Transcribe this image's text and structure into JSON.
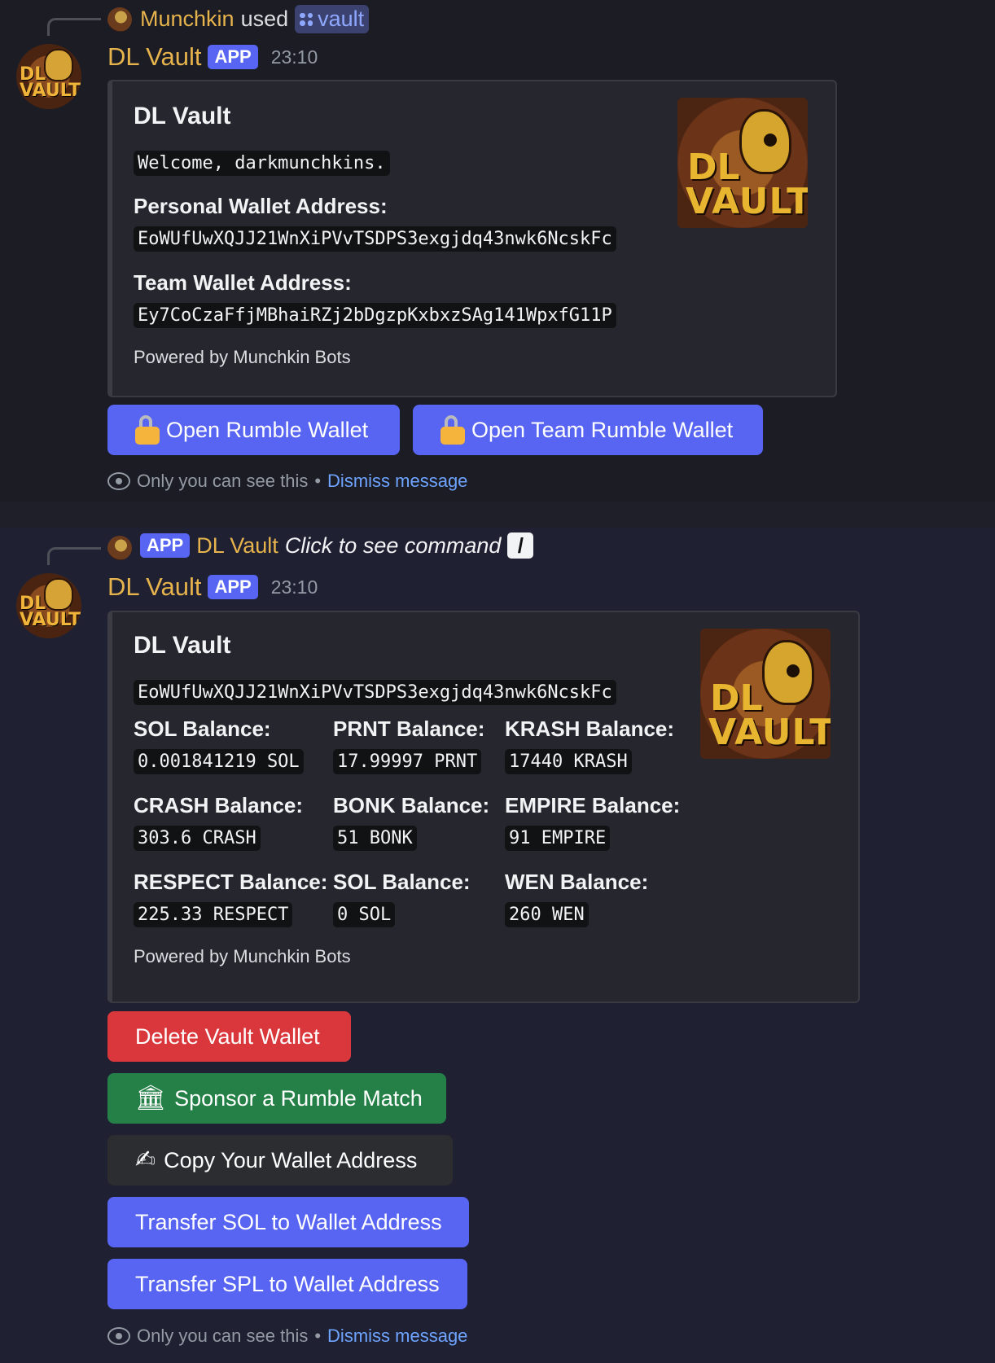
{
  "message1": {
    "reply": {
      "user": "Munchkin",
      "used": "used",
      "command": "vault"
    },
    "bot_name": "DL Vault",
    "badge": "APP",
    "time": "23:10",
    "embed": {
      "title": "DL Vault",
      "welcome": "Welcome, darkmunchkins.",
      "personal_label": "Personal Wallet Address:",
      "personal_address": "EoWUfUwXQJJ21WnXiPVvTSDPS3exgjdq43nwk6NcskFc",
      "team_label": "Team Wallet Address:",
      "team_address": "Ey7CoCzaFfjMBhaiRZj2bDgzpKxbxzSAg141WpxfG11P",
      "footer": "Powered by Munchkin Bots",
      "thumb_line1": "DL",
      "thumb_line2": "VAULT"
    },
    "buttons": {
      "open_rumble": "Open Rumble Wallet",
      "open_team_rumble": "Open Team Rumble Wallet"
    },
    "ephemeral": {
      "note": "Only you can see this",
      "sep": "•",
      "dismiss": "Dismiss message"
    }
  },
  "message2": {
    "reply": {
      "badge": "APP",
      "name": "DL Vault",
      "click": "Click to see command",
      "slash": "/"
    },
    "bot_name": "DL Vault",
    "badge": "APP",
    "time": "23:10",
    "embed": {
      "title": "DL Vault",
      "address": "EoWUfUwXQJJ21WnXiPVvTSDPS3exgjdq43nwk6NcskFc",
      "balances": [
        {
          "label": "SOL Balance:",
          "value": "0.001841219 SOL"
        },
        {
          "label": "PRNT Balance:",
          "value": "17.99997 PRNT"
        },
        {
          "label": "KRASH Balance:",
          "value": "17440 KRASH"
        },
        {
          "label": "CRASH Balance:",
          "value": "303.6 CRASH"
        },
        {
          "label": "BONK Balance:",
          "value": "51 BONK"
        },
        {
          "label": "EMPIRE Balance:",
          "value": "91 EMPIRE"
        },
        {
          "label": "RESPECT Balance:",
          "value": "225.33 RESPECT"
        },
        {
          "label": "SOL Balance:",
          "value": "0 SOL"
        },
        {
          "label": "WEN Balance:",
          "value": "260 WEN"
        }
      ],
      "footer": "Powered by Munchkin Bots",
      "thumb_line1": "DL",
      "thumb_line2": "VAULT"
    },
    "buttons": {
      "delete": "Delete Vault Wallet",
      "sponsor": "Sponsor a Rumble Match",
      "copy": "Copy Your Wallet Address",
      "transfer_sol": "Transfer SOL to Wallet Address",
      "transfer_spl": "Transfer SPL to Wallet Address"
    },
    "ephemeral": {
      "note": "Only you can see this",
      "sep": "•",
      "dismiss": "Dismiss message"
    }
  },
  "avatar_text": "DL VAULT",
  "colors": {
    "blurple": "#5865f2",
    "danger": "#da373c",
    "success": "#248046",
    "secondary": "#2b2d31",
    "bot_name": "#e6b34c",
    "link": "#6ea4ff"
  },
  "icons": [
    "slash-command-icon",
    "lock-icon",
    "bank-icon",
    "writing-hand-icon",
    "eye-icon"
  ]
}
